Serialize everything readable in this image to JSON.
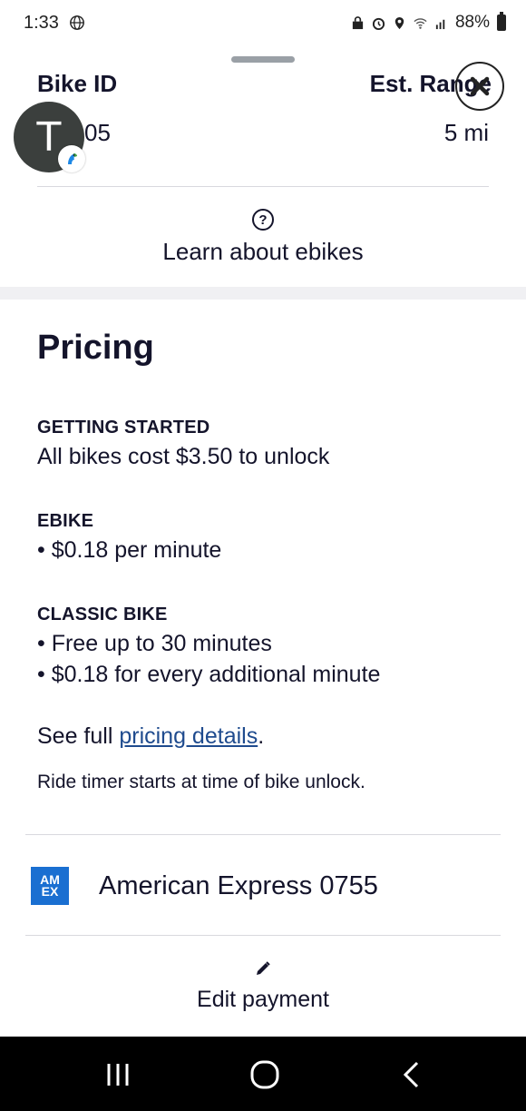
{
  "status_bar": {
    "time": "1:33",
    "battery": "88%"
  },
  "bike": {
    "id_label": "Bike ID",
    "id_value": "05",
    "range_label": "Est. Range",
    "range_value": "5 mi"
  },
  "avatar": {
    "initial": "T"
  },
  "learn": {
    "label": "Learn about ebikes",
    "icon": "question-circle-icon"
  },
  "pricing": {
    "title": "Pricing",
    "sections": [
      {
        "heading": "GETTING STARTED",
        "lines": [
          "All bikes cost $3.50 to unlock"
        ]
      },
      {
        "heading": "EBIKE",
        "lines": [
          "• $0.18 per minute"
        ]
      },
      {
        "heading": "CLASSIC BIKE",
        "lines": [
          "• Free up to 30 minutes",
          "• $0.18 for every additional minute"
        ]
      }
    ],
    "see_full_prefix": "See full ",
    "see_full_link": "pricing details",
    "see_full_suffix": ".",
    "timer_note": "Ride timer starts at time of bike unlock."
  },
  "payment": {
    "card_logo_top": "AM",
    "card_logo_bottom": "EX",
    "card_label": "American Express 0755",
    "edit_label": "Edit payment"
  },
  "colors": {
    "text": "#14142b",
    "link": "#1f4b8e",
    "amex_blue": "#1a6fd1"
  }
}
